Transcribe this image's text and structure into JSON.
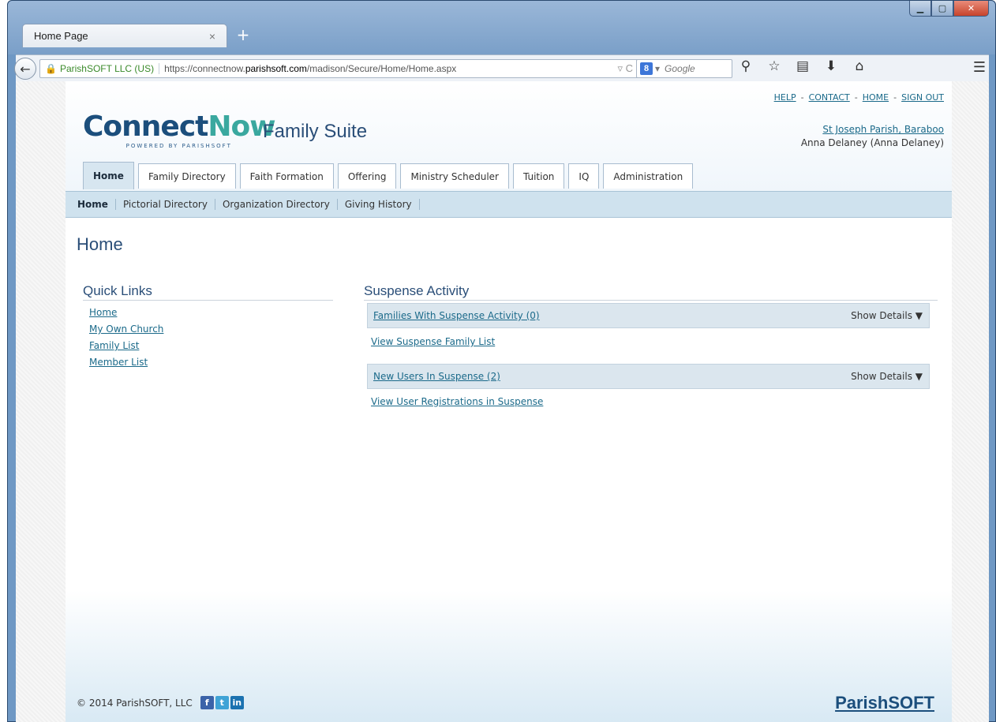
{
  "browser": {
    "tab_title": "Home Page",
    "tab_close": "×",
    "new_tab": "+",
    "site_identity": "ParishSOFT LLC (US)",
    "url_prefix": "https://connectnow.",
    "url_domain": "parishsoft.com",
    "url_path": "/madison/Secure/Home/Home.aspx",
    "url_icons": "▿ C",
    "search_placeholder": "Google",
    "search_engine_badge": "8"
  },
  "header": {
    "logo_text_a": "Connect",
    "logo_text_b": "Now",
    "logo_sub": "POWERED BY PARISHSOFT",
    "suite_title": "Family Suite",
    "top_links": [
      "HELP",
      "CONTACT",
      "HOME",
      "SIGN OUT"
    ],
    "top_link_separator": "-",
    "parish_link": "St Joseph Parish, Baraboo",
    "user_name": "Anna Delaney (Anna Delaney)"
  },
  "main_tabs": [
    {
      "label": "Home",
      "active": true
    },
    {
      "label": "Family Directory",
      "active": false
    },
    {
      "label": "Faith Formation",
      "active": false
    },
    {
      "label": "Offering",
      "active": false
    },
    {
      "label": "Ministry Scheduler",
      "active": false
    },
    {
      "label": "Tuition",
      "active": false
    },
    {
      "label": "IQ",
      "active": false
    },
    {
      "label": "Administration",
      "active": false
    }
  ],
  "sub_nav": [
    {
      "label": "Home",
      "active": true
    },
    {
      "label": "Pictorial Directory",
      "active": false
    },
    {
      "label": "Organization Directory",
      "active": false
    },
    {
      "label": "Giving History",
      "active": false
    }
  ],
  "page_title": "Home",
  "quick_links": {
    "heading": "Quick Links",
    "items": [
      "Home",
      "My Own Church",
      "Family List",
      "Member List"
    ]
  },
  "suspense": {
    "heading": "Suspense Activity",
    "families_label": "Families With Suspense Activity (0)",
    "families_show": "Show Details ▼",
    "families_link": "View Suspense Family List",
    "users_label": "New Users In Suspense (2)",
    "users_show": "Show Details ▼",
    "users_link": "View User Registrations in Suspense"
  },
  "footer": {
    "copyright": "© 2014 ParishSOFT, LLC",
    "social": [
      "f",
      "t",
      "in"
    ],
    "brand": "ParishSOFT"
  },
  "colors": {
    "brand_navy": "#1b4e7c",
    "brand_teal": "#3aa89f",
    "link": "#1b6a8a",
    "subnav_bg": "#cfe2ee"
  }
}
